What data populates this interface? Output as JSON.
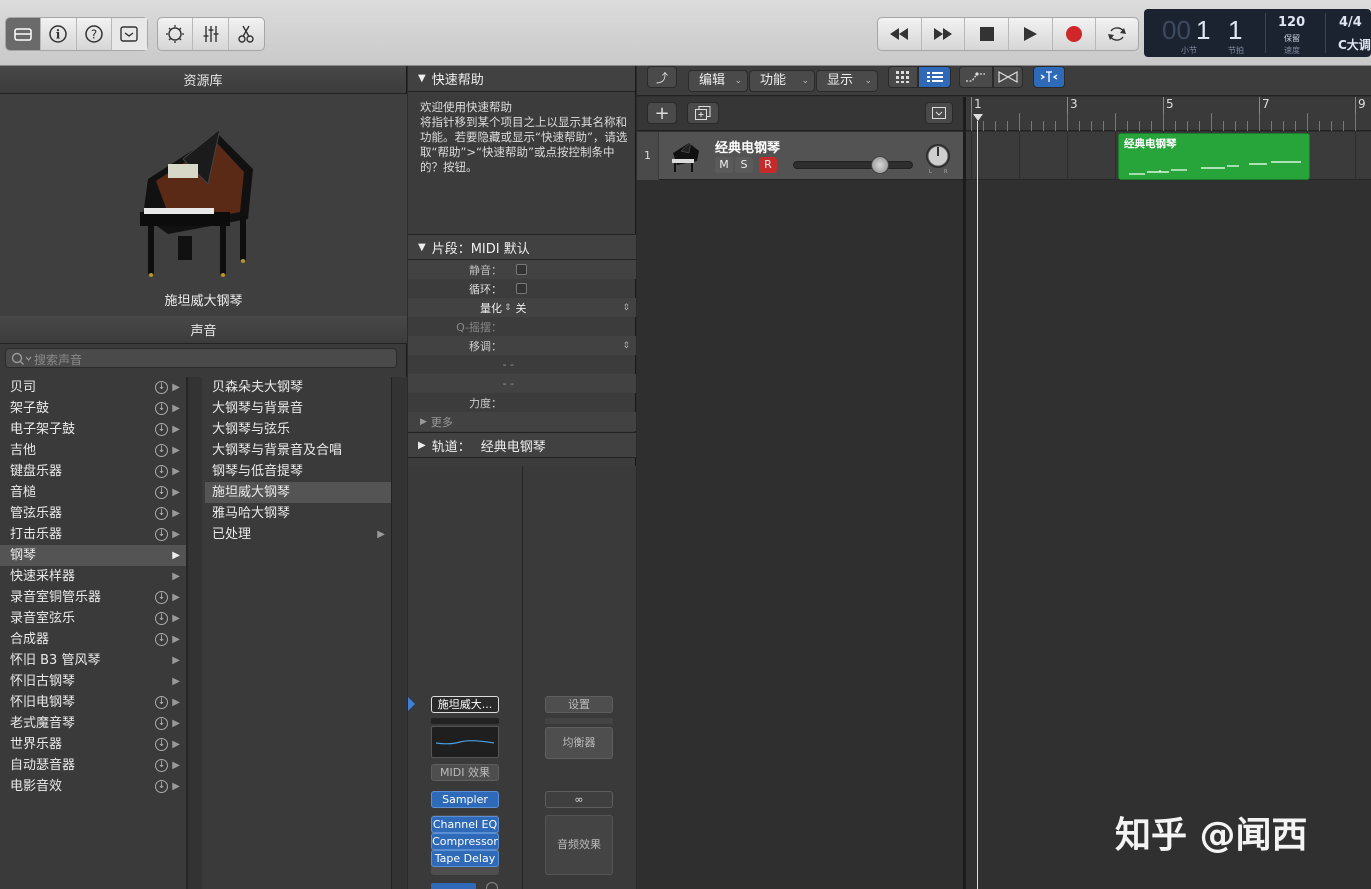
{
  "transport": {
    "bar_value": "1",
    "bar_label": "小节",
    "beat_value": "1",
    "beat_label": "节拍",
    "bar_prefix": "00",
    "tempo": "120",
    "tempo_mode": "保留",
    "tempo_label": "速度",
    "signature": "4/4",
    "key": "C大调"
  },
  "library": {
    "header": "资源库",
    "preview_name": "施坦威大钢琴",
    "sounds_header": "声音",
    "search_placeholder": "搜索声音",
    "categories": [
      {
        "label": "贝司",
        "dl": true,
        "arrow": true
      },
      {
        "label": "架子鼓",
        "dl": true,
        "arrow": true
      },
      {
        "label": "电子架子鼓",
        "dl": true,
        "arrow": true
      },
      {
        "label": "吉他",
        "dl": true,
        "arrow": true
      },
      {
        "label": "键盘乐器",
        "dl": true,
        "arrow": true
      },
      {
        "label": "音槌",
        "dl": true,
        "arrow": true
      },
      {
        "label": "管弦乐器",
        "dl": true,
        "arrow": true
      },
      {
        "label": "打击乐器",
        "dl": true,
        "arrow": true
      },
      {
        "label": "钢琴",
        "dl": false,
        "arrow": true,
        "selected": true
      },
      {
        "label": "快速采样器",
        "dl": false,
        "arrow": true
      },
      {
        "label": "录音室铜管乐器",
        "dl": true,
        "arrow": true
      },
      {
        "label": "录音室弦乐",
        "dl": true,
        "arrow": true
      },
      {
        "label": "合成器",
        "dl": true,
        "arrow": true
      },
      {
        "label": "怀旧 B3 管风琴",
        "dl": false,
        "arrow": true
      },
      {
        "label": "怀旧古钢琴",
        "dl": false,
        "arrow": true
      },
      {
        "label": "怀旧电钢琴",
        "dl": true,
        "arrow": true
      },
      {
        "label": "老式魔音琴",
        "dl": true,
        "arrow": true
      },
      {
        "label": "世界乐器",
        "dl": true,
        "arrow": true
      },
      {
        "label": "自动瑟音器",
        "dl": true,
        "arrow": true
      },
      {
        "label": "电影音效",
        "dl": true,
        "arrow": true
      }
    ],
    "patches": [
      {
        "label": "贝森朵夫大钢琴"
      },
      {
        "label": "大钢琴与背景音"
      },
      {
        "label": "大钢琴与弦乐"
      },
      {
        "label": "大钢琴与背景音及合唱"
      },
      {
        "label": "钢琴与低音提琴"
      },
      {
        "label": "施坦威大钢琴",
        "selected": true
      },
      {
        "label": "雅马哈大钢琴"
      },
      {
        "label": "已处理",
        "arrow": true
      }
    ]
  },
  "quickhelp": {
    "header": "快速帮助",
    "body": "欢迎使用快速帮助\n将指针移到某个项目之上以显示其名称和功能。若要隐藏或显示“快速帮助”，请选取“帮助”>“快速帮助”或点按控制条中的？按钮。"
  },
  "region": {
    "header": "片段：MIDI 默认",
    "mute_label": "静音：",
    "loop_label": "循环：",
    "quantize_label": "量化",
    "quantize_value": "关",
    "qswing_label": "Q-摇摆：",
    "transpose_label": "移调：",
    "dash1": "- -",
    "dash2": "- -",
    "velocity_label": "力度：",
    "more_label": "更多"
  },
  "track_section": {
    "label": "轨道：",
    "value": "经典电钢琴"
  },
  "channel": {
    "patch_slot": "施坦威大...",
    "midi_fx": "MIDI 效果",
    "instrument": "Sampler",
    "fx": [
      "Channel EQ",
      "Compressor",
      "Tape Delay"
    ],
    "settings": "设置",
    "eq": "均衡器",
    "link": "∞",
    "audio_fx": "音频效果"
  },
  "trackarea": {
    "menus": [
      "编辑",
      "功能",
      "显示"
    ],
    "ruler": [
      "1",
      "3",
      "5",
      "7",
      "9"
    ],
    "track_number": "1",
    "track_name": "经典电钢琴",
    "m": "M",
    "s": "S",
    "r": "R",
    "region_name": "经典电钢琴",
    "volume": 0.72
  },
  "watermark": "知乎 @闻西",
  "colors": {
    "region_green": "#27a53b",
    "record_red": "#d0272b",
    "accent_blue": "#2f6ab8"
  }
}
